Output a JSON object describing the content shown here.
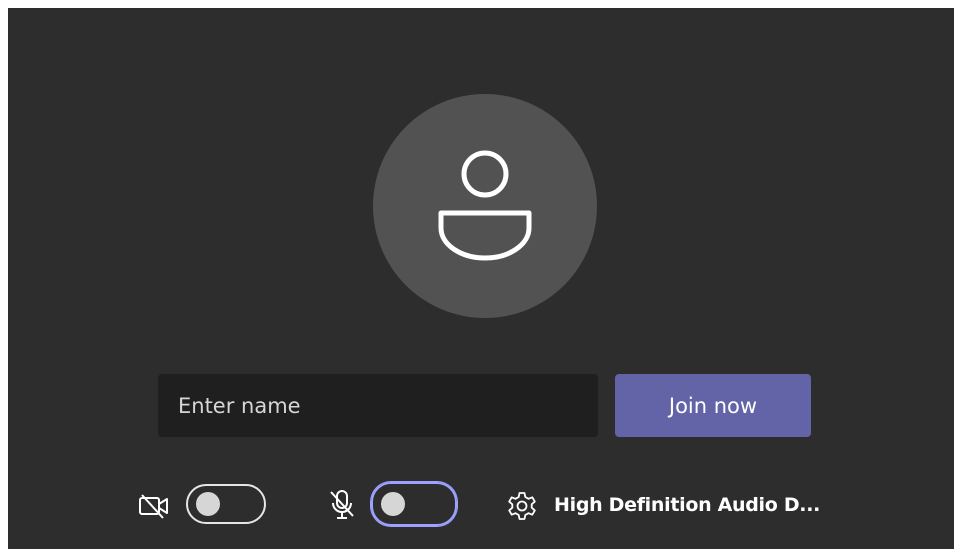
{
  "prejoin": {
    "avatar": {
      "icon": "person-icon"
    },
    "name_input": {
      "placeholder": "Enter name",
      "value": ""
    },
    "join_label": "Join now",
    "camera": {
      "icon": "camera-off-icon",
      "enabled": false
    },
    "microphone": {
      "icon": "mic-off-icon",
      "enabled": false
    },
    "device": {
      "icon": "gear-icon",
      "label": "High Definition Audio D..."
    }
  },
  "colors": {
    "background": "#2d2d2d",
    "avatar": "#525252",
    "input": "#1f1f1f",
    "accent": "#6264a7",
    "focus_ring": "#9ea2ff"
  }
}
